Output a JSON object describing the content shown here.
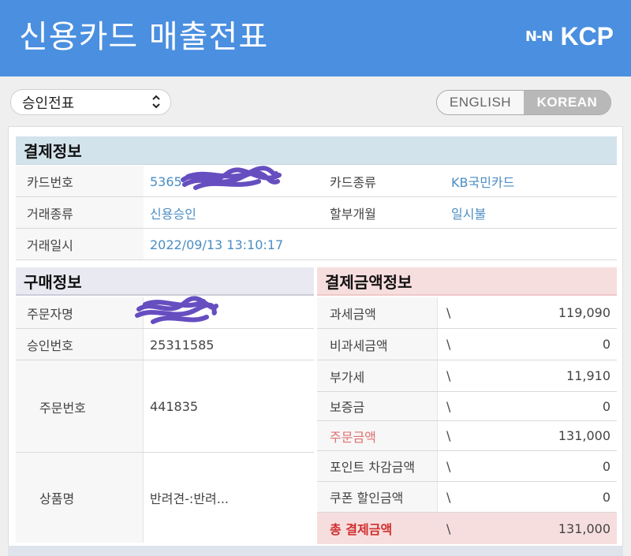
{
  "header": {
    "title": "신용카드 매출전표",
    "logo_mark": "N-N",
    "logo_text": "KCP"
  },
  "select": {
    "value": "승인전표"
  },
  "lang": {
    "en": "ENGLISH",
    "ko": "KOREAN"
  },
  "payment": {
    "title": "결제정보",
    "card_no_label": "카드번호",
    "card_no_value": "5365",
    "card_type_label": "카드종류",
    "card_type_value": "KB국민카드",
    "tx_type_label": "거래종류",
    "tx_type_value": "신용승인",
    "install_label": "할부개월",
    "install_value": "일시불",
    "date_label": "거래일시",
    "date_value": "2022/09/13 13:10:17"
  },
  "purchase": {
    "title": "구매정보",
    "buyer_label": "주문자명",
    "approval_label": "승인번호",
    "approval_value": "25311585",
    "order_label": "주문번호",
    "order_value": "441835",
    "product_label": "상품명",
    "product_value": "반려견-:반려..."
  },
  "amount": {
    "title": "결제금액정보",
    "currency": "\\",
    "rows": [
      {
        "label": "과세금액",
        "value": "119,090"
      },
      {
        "label": "비과세금액",
        "value": "0"
      },
      {
        "label": "부가세",
        "value": "11,910"
      },
      {
        "label": "보증금",
        "value": "0"
      },
      {
        "label": "주문금액",
        "value": "131,000"
      },
      {
        "label": "포인트 차감금액",
        "value": "0"
      },
      {
        "label": "쿠폰 할인금액",
        "value": "0"
      },
      {
        "label": "총 결제금액",
        "value": "131,000"
      }
    ]
  }
}
